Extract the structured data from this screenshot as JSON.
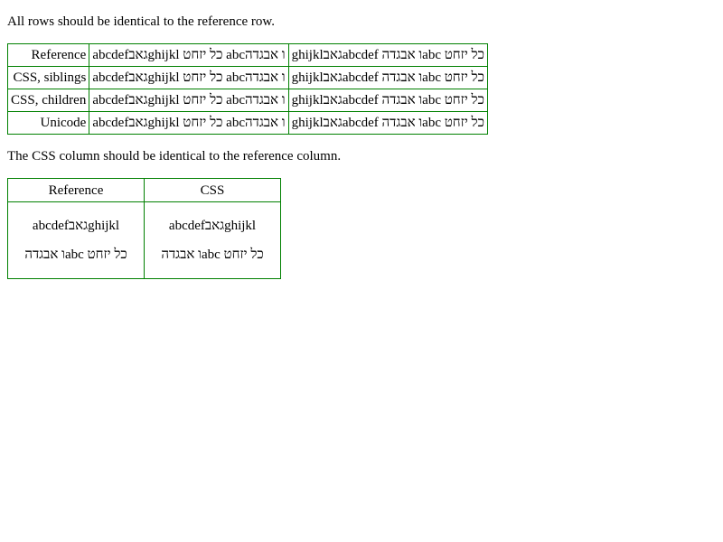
{
  "notes": {
    "rows_identical": "All rows should be identical to the reference row.",
    "column_identical": "The CSS column should be identical to the reference column."
  },
  "comparison_table": {
    "rows": [
      {
        "label": "Reference",
        "rtl_text": "abcdefגאבghijkl כל יזחט abcו אבגדה",
        "ltr_text": "כל יזחט abcו אבגדה abcdefגאבghijkl"
      },
      {
        "label": "CSS, siblings",
        "rtl_text": "abcdefגאבghijkl כל יזחט abcו אבגדה",
        "ltr_text": "כל יזחט abcו אבגדה abcdefגאבghijkl"
      },
      {
        "label": "CSS, children",
        "rtl_text": "abcdefגאבghijkl כל יזחט abcו אבגדה",
        "ltr_text": "כל יזחט abcו אבגדה abcdefגאבghijkl"
      },
      {
        "label": "Unicode",
        "rtl_text": "abcdefגאבghijkl כל יזחט abcו אבגדה",
        "ltr_text": "כל יזחט abcו אבגדה abcdefגאבghijkl"
      }
    ]
  },
  "column_table": {
    "headers": [
      "Reference",
      "CSS"
    ],
    "reference": {
      "line1": "abcdefגאבghijkl",
      "line2": "כל יזחט abcו אבגדה"
    },
    "css": {
      "line1": "abcdefגאבghijkl",
      "line2": "כל יזחט abcו אבגדה"
    }
  },
  "colors": {
    "border": "#008000",
    "text": "#000000",
    "background": "#ffffff"
  }
}
